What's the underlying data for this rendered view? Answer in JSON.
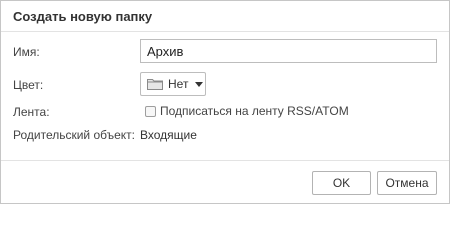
{
  "dialog": {
    "title": "Создать новую папку",
    "fields": {
      "name_label": "Имя:",
      "name_value": "Архив",
      "color_label": "Цвет:",
      "color_value": "Нет",
      "feed_label": "Лента:",
      "feed_checkbox_label": "Подписаться на ленту RSS/ATOM",
      "feed_checked": false,
      "parent_label": "Родительский объект:",
      "parent_value": "Входящие"
    },
    "buttons": {
      "ok": "OK",
      "cancel": "Отмена"
    },
    "icons": {
      "color_dropdown": "folder-icon",
      "dropdown_caret": "chevron-down-icon"
    }
  }
}
